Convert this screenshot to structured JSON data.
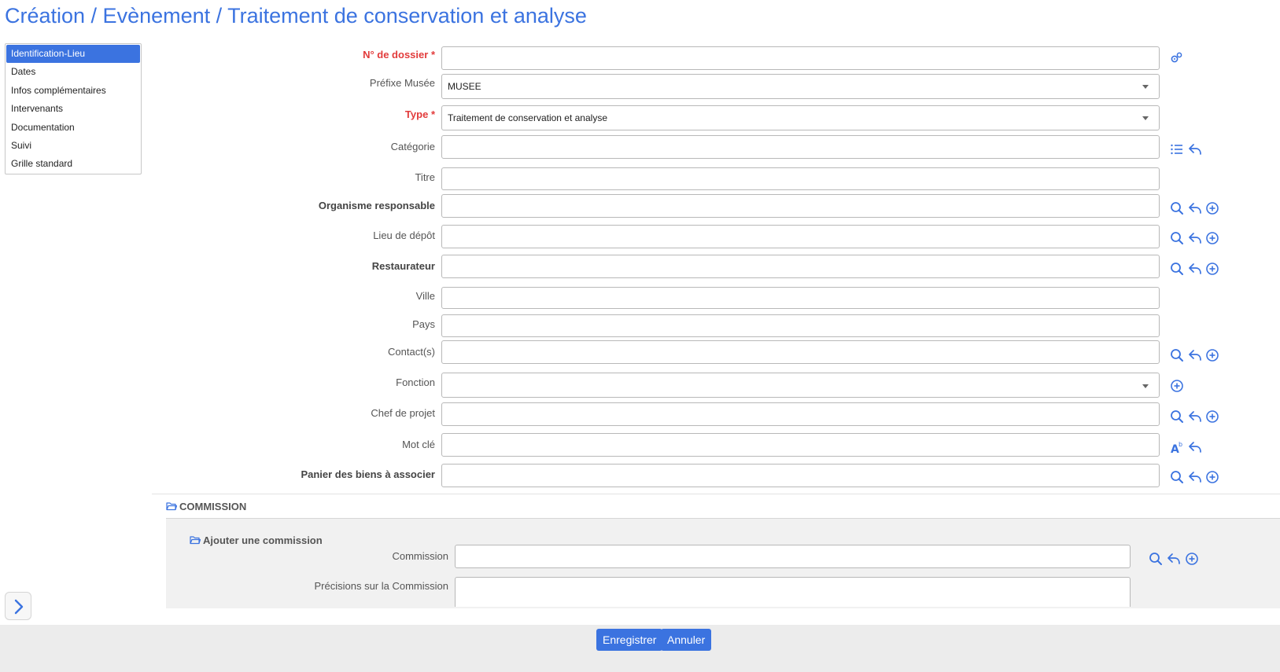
{
  "page": {
    "title": "Création / Evènement / Traitement de conservation et analyse"
  },
  "sidebar": {
    "items": [
      {
        "label": "Identification-Lieu",
        "active": true
      },
      {
        "label": "Dates"
      },
      {
        "label": "Infos complémentaires"
      },
      {
        "label": "Intervenants"
      },
      {
        "label": "Documentation"
      },
      {
        "label": "Suivi"
      },
      {
        "label": "Grille standard"
      }
    ]
  },
  "form": {
    "dossier": {
      "label": "N° de dossier",
      "required_mark": "*",
      "value": ""
    },
    "prefixe": {
      "label": "Préfixe Musée",
      "value": "MUSEE"
    },
    "type": {
      "label": "Type",
      "required_mark": "*",
      "value": "Traitement de conservation et analyse"
    },
    "categorie": {
      "label": "Catégorie",
      "value": ""
    },
    "titre": {
      "label": "Titre",
      "value": ""
    },
    "organisme": {
      "label": "Organisme responsable",
      "value": ""
    },
    "lieu": {
      "label": "Lieu de dépôt",
      "value": ""
    },
    "restaurateur": {
      "label": "Restaurateur",
      "value": ""
    },
    "ville": {
      "label": "Ville",
      "value": ""
    },
    "pays": {
      "label": "Pays",
      "value": ""
    },
    "contacts": {
      "label": "Contact(s)",
      "value": ""
    },
    "fonction": {
      "label": "Fonction",
      "value": ""
    },
    "chef": {
      "label": "Chef de projet",
      "value": ""
    },
    "motcle": {
      "label": "Mot clé",
      "value": ""
    },
    "panier": {
      "label": "Panier des biens à associer",
      "value": ""
    }
  },
  "commission": {
    "section_title": "COMMISSION",
    "add_title": "Ajouter une commission",
    "commission_label": "Commission",
    "precisions_label": "Précisions sur la Commission"
  },
  "footer": {
    "save": "Enregistrer",
    "cancel": "Annuler"
  },
  "colors": {
    "accent": "#3b73e0",
    "required": "#e23b3b",
    "footer_bg": "#ececec"
  }
}
